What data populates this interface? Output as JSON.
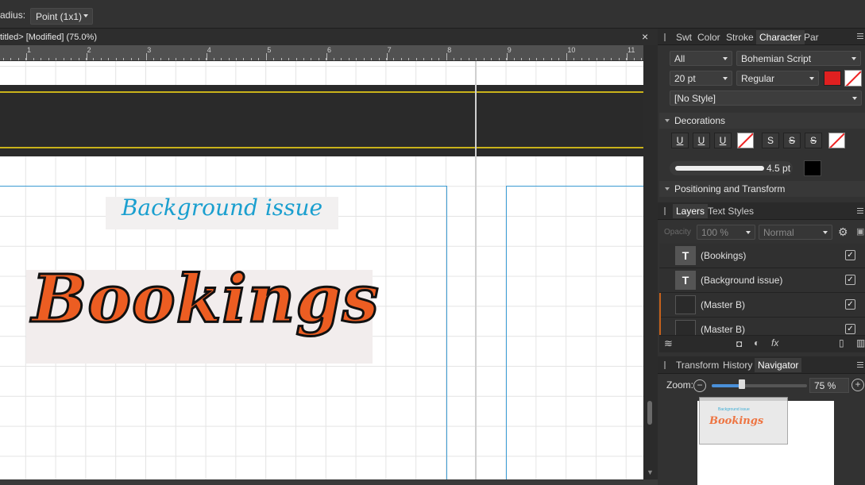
{
  "toolbar": {
    "radius_label": "adius:",
    "radius_value": "Point (1x1)"
  },
  "document": {
    "tab_title": "titled> [Modified] (75.0%)",
    "close": "×"
  },
  "ruler": {
    "marks": [
      "1",
      "2",
      "3",
      "4",
      "5",
      "6",
      "7",
      "8",
      "9",
      "10",
      "11"
    ]
  },
  "canvas": {
    "text_background_issue": "Background issue",
    "text_bookings": "Bookings"
  },
  "character_panel": {
    "tabs": [
      "Swt",
      "Color",
      "Stroke",
      "Character",
      "Par"
    ],
    "active_tab": "Character",
    "scope": "All",
    "font": "Bohemian Script",
    "size": "20 pt",
    "weight": "Regular",
    "style": "[No Style]",
    "fill_color": "#e02020"
  },
  "decorations": {
    "title": "Decorations",
    "underline_buttons": [
      "U",
      "U",
      "U"
    ],
    "strike_buttons": [
      "S",
      "S",
      "S"
    ],
    "stroke_width": "4.5 pt",
    "color": "#000000"
  },
  "positioning": {
    "title": "Positioning and Transform"
  },
  "layers_panel": {
    "tabs": [
      "Layers",
      "Text Styles"
    ],
    "active_tab": "Layers",
    "opacity_label": "Opacity",
    "opacity": "100 %",
    "blend": "Normal",
    "rows": [
      {
        "name": "(Bookings)"
      },
      {
        "name": "(Background issue)"
      },
      {
        "name": "(Master B)"
      },
      {
        "name": "(Master B)"
      }
    ]
  },
  "navigator_panel": {
    "tabs": [
      "Transform",
      "History",
      "Navigator"
    ],
    "active_tab": "Navigator",
    "zoom_label": "Zoom:",
    "zoom_value": "75 %",
    "zoom_fraction": 0.32
  }
}
